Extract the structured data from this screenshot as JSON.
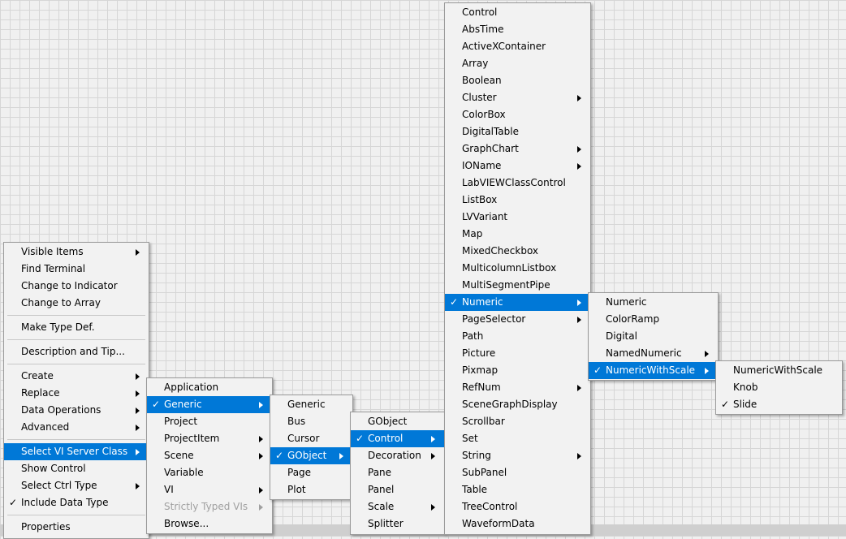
{
  "context_menu": {
    "visible_items": "Visible Items",
    "find_terminal": "Find Terminal",
    "change_to_indicator": "Change to Indicator",
    "change_to_array": "Change to Array",
    "make_type_def": "Make Type Def.",
    "description_and_tip": "Description and Tip...",
    "create": "Create",
    "replace": "Replace",
    "data_operations": "Data Operations",
    "advanced": "Advanced",
    "select_vi_server_class": "Select VI Server Class",
    "show_control": "Show Control",
    "select_ctrl_type": "Select Ctrl Type",
    "include_data_type": "Include Data Type",
    "properties": "Properties"
  },
  "server_class_menu": {
    "application": "Application",
    "generic": "Generic",
    "project": "Project",
    "project_item": "ProjectItem",
    "scene": "Scene",
    "variable": "Variable",
    "vi": "VI",
    "strictly_typed_vis": "Strictly Typed VIs",
    "browse": "Browse..."
  },
  "generic_menu": {
    "generic": "Generic",
    "bus": "Bus",
    "cursor": "Cursor",
    "gobject": "GObject",
    "page": "Page",
    "plot": "Plot"
  },
  "gobject_menu": {
    "gobject": "GObject",
    "control": "Control",
    "decoration": "Decoration",
    "pane": "Pane",
    "panel": "Panel",
    "scale": "Scale",
    "splitter": "Splitter"
  },
  "control_menu": {
    "control": "Control",
    "abs_time": "AbsTime",
    "activex_container": "ActiveXContainer",
    "array": "Array",
    "boolean": "Boolean",
    "cluster": "Cluster",
    "color_box": "ColorBox",
    "digital_table": "DigitalTable",
    "graph_chart": "GraphChart",
    "io_name": "IOName",
    "labview_class_control": "LabVIEWClassControl",
    "list_box": "ListBox",
    "lv_variant": "LVVariant",
    "map": "Map",
    "mixed_checkbox": "MixedCheckbox",
    "multicolumn_listbox": "MulticolumnListbox",
    "multi_segment_pipe": "MultiSegmentPipe",
    "numeric": "Numeric",
    "page_selector": "PageSelector",
    "path": "Path",
    "picture": "Picture",
    "pixmap": "Pixmap",
    "ref_num": "RefNum",
    "scene_graph_display": "SceneGraphDisplay",
    "scrollbar": "Scrollbar",
    "set": "Set",
    "string": "String",
    "sub_panel": "SubPanel",
    "table": "Table",
    "tree_control": "TreeControl",
    "waveform_data": "WaveformData"
  },
  "numeric_menu": {
    "numeric": "Numeric",
    "color_ramp": "ColorRamp",
    "digital": "Digital",
    "named_numeric": "NamedNumeric",
    "numeric_with_scale": "NumericWithScale"
  },
  "numeric_with_scale_menu": {
    "numeric_with_scale": "NumericWithScale",
    "knob": "Knob",
    "slide": "Slide"
  },
  "check_mark": "✓",
  "colors": {
    "highlight": "#0078d7",
    "menu_bg": "#f2f2f2",
    "disabled_text": "#a0a0a0"
  }
}
